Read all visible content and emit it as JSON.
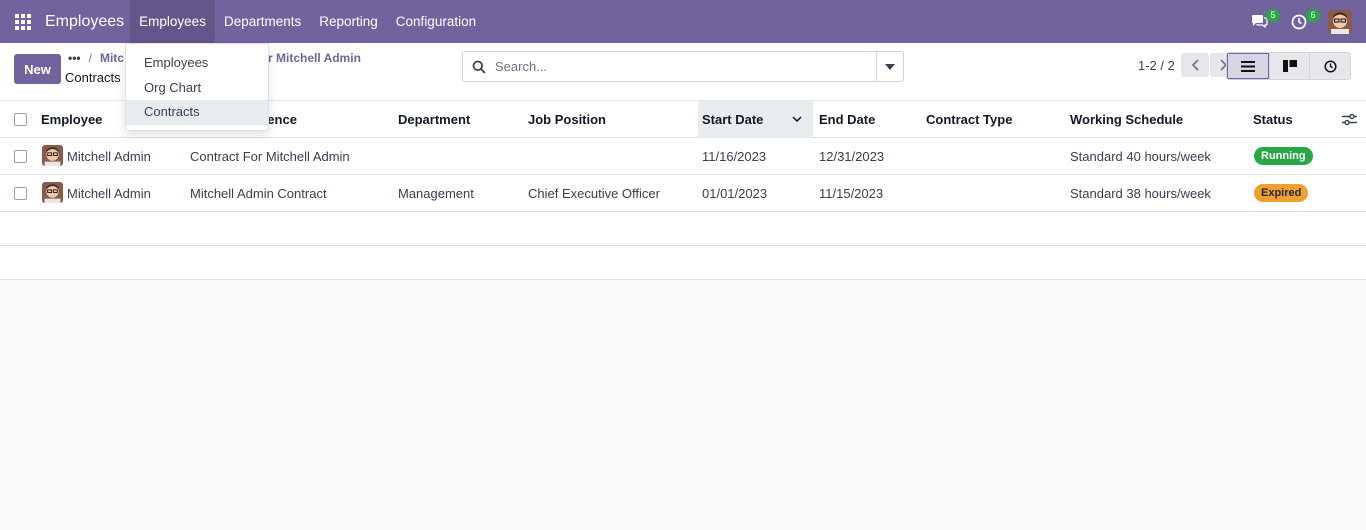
{
  "navbar": {
    "app_name": "Employees",
    "menus": [
      {
        "label": "Employees"
      },
      {
        "label": "Departments"
      },
      {
        "label": "Reporting"
      },
      {
        "label": "Configuration"
      }
    ],
    "messages_count": "5",
    "activities_count": "6"
  },
  "control": {
    "new_label": "New",
    "breadcrumb_dots": "•••",
    "breadcrumb_sep": "/",
    "breadcrumb_parent": "Mitc",
    "breadcrumb_parent_tail": "r Mitchell Admin",
    "breadcrumb_current": "Contracts",
    "search_placeholder": "Search...",
    "pager": "1-2 / 2"
  },
  "dropdown": {
    "items": [
      {
        "label": "Employees"
      },
      {
        "label": "Org Chart"
      },
      {
        "label": "Contracts"
      }
    ]
  },
  "table": {
    "columns": {
      "employee": "Employee",
      "reference": "Reference",
      "reference_visible": "erence",
      "department": "Department",
      "job_position": "Job Position",
      "start_date": "Start Date",
      "end_date": "End Date",
      "contract_type": "Contract Type",
      "working_schedule": "Working Schedule",
      "status": "Status"
    },
    "rows": [
      {
        "employee": "Mitchell Admin",
        "reference": "Contract For Mitchell Admin",
        "department": "",
        "job_position": "",
        "start_date": "11/16/2023",
        "end_date": "12/31/2023",
        "contract_type": "",
        "working_schedule": "Standard 40 hours/week",
        "status": "Running"
      },
      {
        "employee": "Mitchell Admin",
        "reference": "Mitchell Admin Contract",
        "department": "Management",
        "job_position": "Chief Executive Officer",
        "start_date": "01/01/2023",
        "end_date": "11/15/2023",
        "contract_type": "",
        "working_schedule": "Standard 38 hours/week",
        "status": "Expired"
      }
    ]
  },
  "colors": {
    "brand": "#71639e",
    "running": "#28a745",
    "expired": "#f0a030"
  }
}
